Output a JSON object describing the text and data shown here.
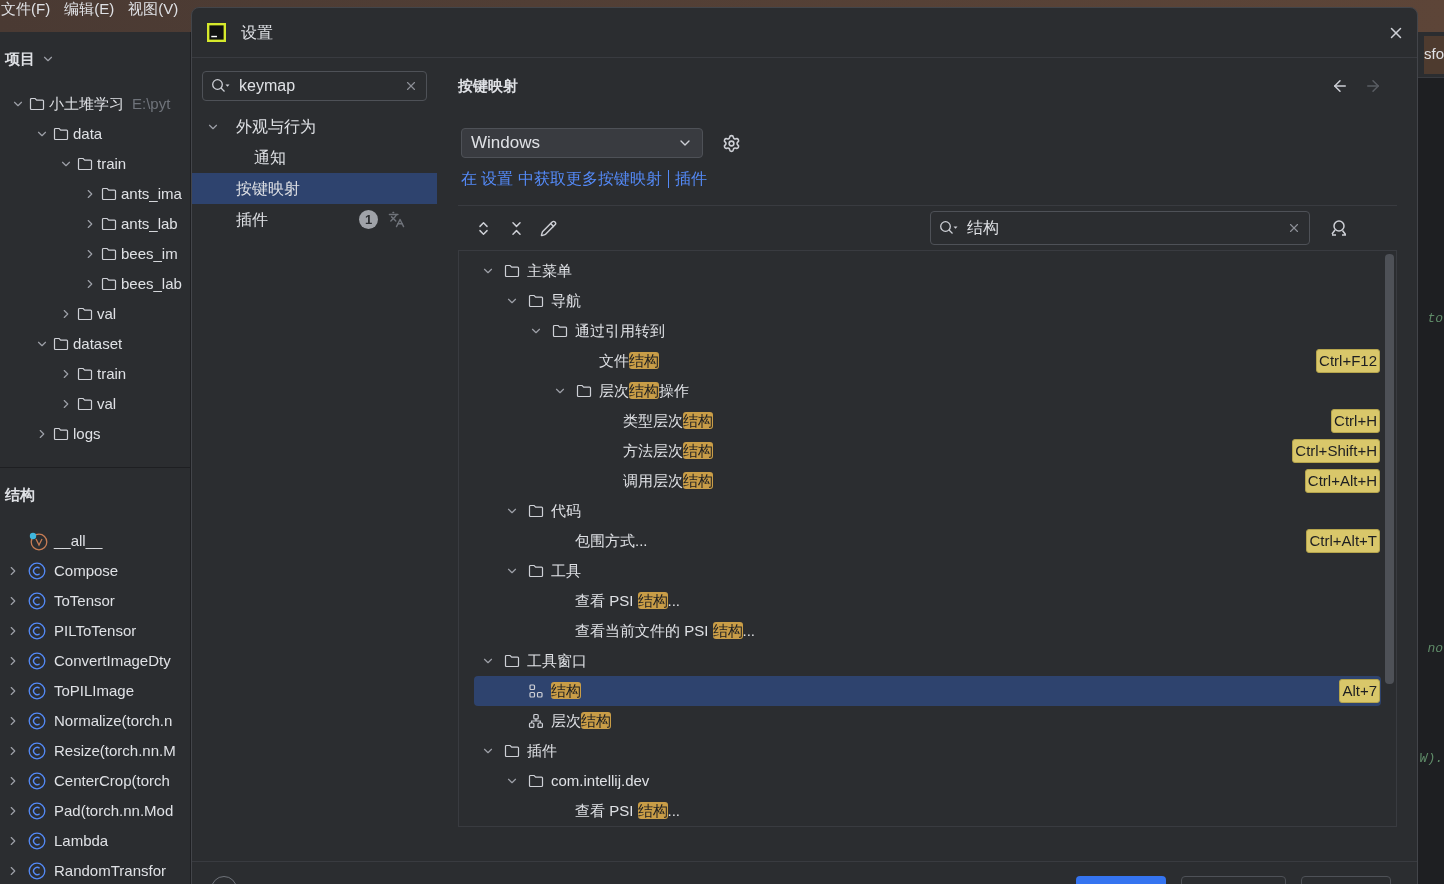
{
  "ide": {
    "menu": [
      "文件(F)",
      "编辑(E)",
      "视图(V)"
    ],
    "project_panel": {
      "title": "项目",
      "tree": [
        {
          "label": "小土堆学习",
          "path": "E:\\pyt",
          "expanded": true,
          "children": [
            {
              "label": "data",
              "expanded": true,
              "children": [
                {
                  "label": "train",
                  "expanded": true,
                  "children": [
                    {
                      "label": "ants_ima",
                      "expanded": false
                    },
                    {
                      "label": "ants_lab",
                      "expanded": false
                    },
                    {
                      "label": "bees_im",
                      "expanded": false
                    },
                    {
                      "label": "bees_lab",
                      "expanded": false
                    }
                  ]
                },
                {
                  "label": "val",
                  "expanded": false
                }
              ]
            },
            {
              "label": "dataset",
              "expanded": true,
              "children": [
                {
                  "label": "train",
                  "expanded": false
                },
                {
                  "label": "val",
                  "expanded": false
                }
              ]
            },
            {
              "label": "logs",
              "expanded": false
            }
          ]
        }
      ]
    },
    "structure_panel": {
      "title": "结构",
      "items": [
        {
          "label": "__all__",
          "kind": "variable"
        },
        {
          "label": "Compose",
          "kind": "class",
          "expanded": false
        },
        {
          "label": "ToTensor",
          "kind": "class",
          "expanded": false
        },
        {
          "label": "PILToTensor",
          "kind": "class",
          "expanded": false
        },
        {
          "label": "ConvertImageDty",
          "kind": "class",
          "expanded": false
        },
        {
          "label": "ToPILImage",
          "kind": "class",
          "expanded": false
        },
        {
          "label": "Normalize(torch.n",
          "kind": "class",
          "expanded": false
        },
        {
          "label": "Resize(torch.nn.M",
          "kind": "class",
          "expanded": false
        },
        {
          "label": "CenterCrop(torch",
          "kind": "class",
          "expanded": false
        },
        {
          "label": "Pad(torch.nn.Mod",
          "kind": "class",
          "expanded": false
        },
        {
          "label": "Lambda",
          "kind": "class",
          "expanded": false
        },
        {
          "label": "RandomTransfor",
          "kind": "class",
          "expanded": false
        }
      ]
    },
    "editor": {
      "tab": "sfo",
      "fragments": [
        "to",
        "no",
        "W)."
      ]
    }
  },
  "dialog": {
    "title": "设置",
    "search": {
      "value": "keymap"
    },
    "nav": [
      {
        "label": "外观与行为",
        "expanded": true,
        "selected": false,
        "children": [
          {
            "label": "通知",
            "selected": false
          }
        ]
      },
      {
        "label": "按键映射",
        "selected": true
      },
      {
        "label": "插件",
        "selected": false,
        "badge": "1",
        "translatable": true
      }
    ],
    "keymap": {
      "heading": "按键映射",
      "scheme": "Windows",
      "link_text": "在 设置 中获取更多按键映射",
      "link": "插件",
      "filter": {
        "value": "结构"
      },
      "tree": [
        {
          "label": "主菜单",
          "kind": "folder",
          "expanded": true,
          "selected": false,
          "children": [
            {
              "label": "导航",
              "kind": "folder",
              "expanded": true,
              "selected": false,
              "children": [
                {
                  "label": "通过引用转到",
                  "kind": "folder",
                  "expanded": true,
                  "selected": false,
                  "children": [
                    {
                      "label": "文件**结构**",
                      "selected": false,
                      "shortcut": "Ctrl+F12"
                    },
                    {
                      "label": "层次**结构**操作",
                      "kind": "folder",
                      "expanded": true,
                      "selected": false,
                      "children": [
                        {
                          "label": "类型层次**结构**",
                          "selected": false,
                          "shortcut": "Ctrl+H"
                        },
                        {
                          "label": "方法层次**结构**",
                          "selected": false,
                          "shortcut": "Ctrl+Shift+H"
                        },
                        {
                          "label": "调用层次**结构**",
                          "selected": false,
                          "shortcut": "Ctrl+Alt+H"
                        }
                      ]
                    }
                  ]
                }
              ]
            },
            {
              "label": "代码",
              "kind": "folder",
              "expanded": true,
              "selected": false,
              "children": [
                {
                  "label": "包围方式...",
                  "selected": false,
                  "shortcut": "Ctrl+Alt+T"
                }
              ]
            },
            {
              "label": "工具",
              "kind": "folder",
              "expanded": true,
              "selected": false,
              "children": [
                {
                  "label": "查看 PSI **结构**...",
                  "selected": false
                },
                {
                  "label": "查看当前文件的 PSI **结构**...",
                  "selected": false
                }
              ]
            }
          ]
        },
        {
          "label": "工具窗口",
          "kind": "folder",
          "expanded": true,
          "selected": false,
          "children": [
            {
              "label": "**结构**",
              "kind": "structure",
              "selected": true,
              "shortcut": "Alt+7"
            },
            {
              "label": "层次**结构**",
              "kind": "hierarchy",
              "selected": false
            }
          ]
        },
        {
          "label": "插件",
          "kind": "folder",
          "expanded": true,
          "selected": false,
          "children": [
            {
              "label": "com.intellij.dev",
              "kind": "folder",
              "expanded": true,
              "selected": false,
              "children": [
                {
                  "label": "查看 PSI **结构**...",
                  "selected": false
                }
              ]
            }
          ]
        }
      ]
    }
  }
}
